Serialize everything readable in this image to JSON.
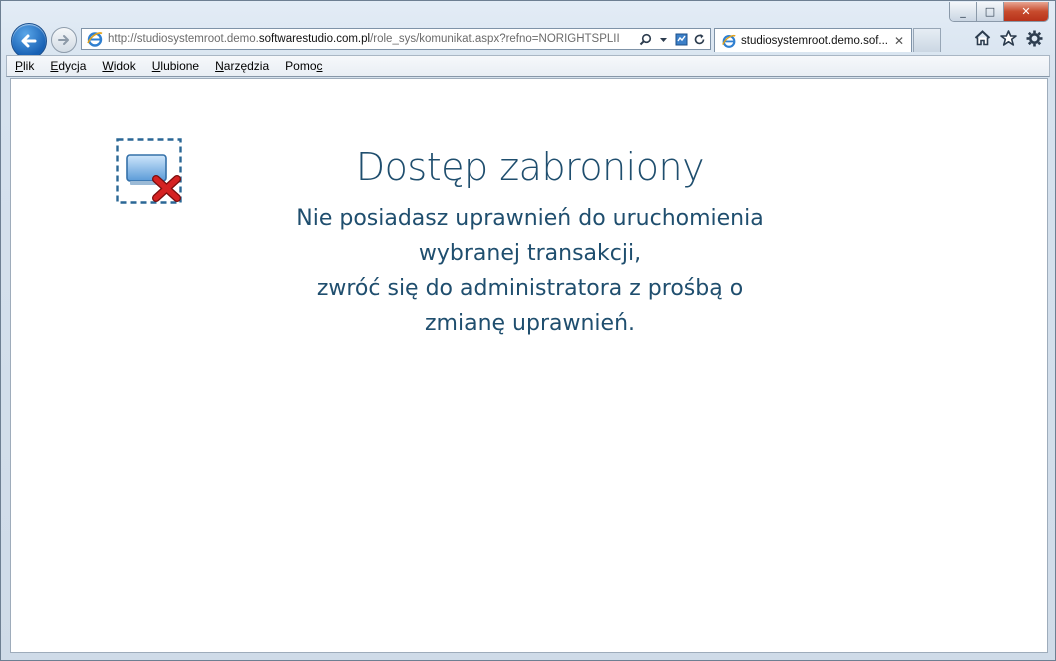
{
  "window": {
    "minimize_glyph": "_",
    "maximize_glyph": "□",
    "close_glyph": "✕"
  },
  "address_bar": {
    "url_prefix": "http://studiosystemroot.demo.",
    "url_host": "softwarestudio.com.pl",
    "url_suffix": "/role_sys/komunikat.aspx?refno=NORIGHTSPLII",
    "search_icon": "search-icon",
    "dropdown_icon": "chevron-down-icon",
    "compat_icon": "compatibility-icon",
    "refresh_icon": "refresh-icon"
  },
  "tab": {
    "title": "studiosystemroot.demo.sof...",
    "close_glyph": "✕"
  },
  "toolbar_icons": [
    "home-icon",
    "star-icon",
    "gear-icon"
  ],
  "menu": {
    "items": [
      {
        "label_pre": "",
        "label_u": "P",
        "label_post": "lik"
      },
      {
        "label_pre": "",
        "label_u": "E",
        "label_post": "dycja"
      },
      {
        "label_pre": "",
        "label_u": "W",
        "label_post": "idok"
      },
      {
        "label_pre": "",
        "label_u": "U",
        "label_post": "lubione"
      },
      {
        "label_pre": "",
        "label_u": "N",
        "label_post": "arzędzia"
      },
      {
        "label_pre": "Pomo",
        "label_u": "c",
        "label_post": ""
      }
    ]
  },
  "message": {
    "title": "Dostęp zabroniony",
    "lines": [
      "Nie posiadasz uprawnień do uruchomienia",
      "wybranej transakcji,",
      "zwróć się do administratora z prośbą o",
      "zmianę uprawnień."
    ]
  },
  "colors": {
    "accent": "#1f4e6e",
    "error_red": "#d52222",
    "back_button": "#1760b4"
  }
}
